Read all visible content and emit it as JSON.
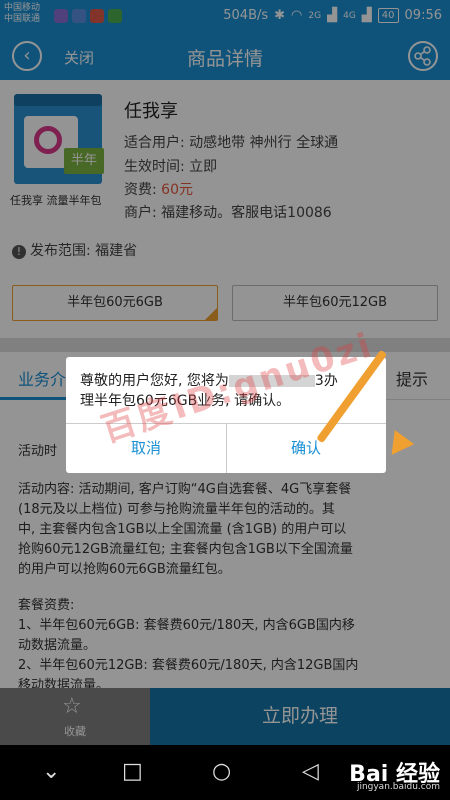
{
  "status_bar": {
    "carrier1": "中国移动",
    "carrier2": "中国联通",
    "speed": "504B/s",
    "network1": "2G",
    "network2": "4G",
    "battery": "40",
    "time": "09:56"
  },
  "title_bar": {
    "close_label": "关闭",
    "title": "商品详情"
  },
  "product": {
    "image_tag": "半年",
    "image_caption": "任我享 流量半年包",
    "name": "任我享",
    "users": "适合用户: 动感地带 神州行 全球通",
    "effective": "生效时间: 立即",
    "fee_label": "资费: ",
    "fee_value": "60元",
    "merchant": "商户: 福建移动。客服电话10086",
    "scope": "发布范围: 福建省"
  },
  "options": [
    {
      "label": "半年包60元6GB",
      "selected": true
    },
    {
      "label": "半年包60元12GB",
      "selected": false
    }
  ],
  "tabs": [
    {
      "label": "业务介"
    },
    {
      "label": "提示"
    }
  ],
  "content": {
    "activity_time": "活动时",
    "para1_line1": "活动内容: 活动期间, 客户订购“4G自选套餐、4G飞享套餐",
    "para1_line2": "(18元及以上档位) 可参与抢购流量半年包的活动的。其",
    "para1_line3": "中, 主套餐内包含1GB以上全国流量 (含1GB) 的用户可以",
    "para1_line4": "抢购60元12GB流量红包; 主套餐内包含1GB以下全国流量",
    "para1_line5": "的用户可以抢购60元6GB流量红包。",
    "fee_title": "套餐资费:",
    "fee1_line1": "1、半年包60元6GB: 套餐费60元/180天, 内含6GB国内移",
    "fee1_line2": "动数据流量。",
    "fee2_line1": "2、半年包60元12GB: 套餐费60元/180天, 内含12GB国内",
    "fee2_line2": "移动数据流量。"
  },
  "dialog": {
    "message_line1": "尊敬的用户您好, 您将为",
    "message_line1b": "3办",
    "message_line2": "理半年包60元6GB业务, 请确认。",
    "cancel": "取消",
    "confirm": "确认"
  },
  "bottom": {
    "favorite": "收藏",
    "apply": "立即办理"
  },
  "watermark": {
    "text": "百度ID:gnu0zi",
    "baidu": "Bai 经验",
    "baidu_url": "jingyan.baidu.com"
  },
  "colors": {
    "primary": "#1a90d4",
    "accent": "#f0a030",
    "price": "#e5573f"
  }
}
